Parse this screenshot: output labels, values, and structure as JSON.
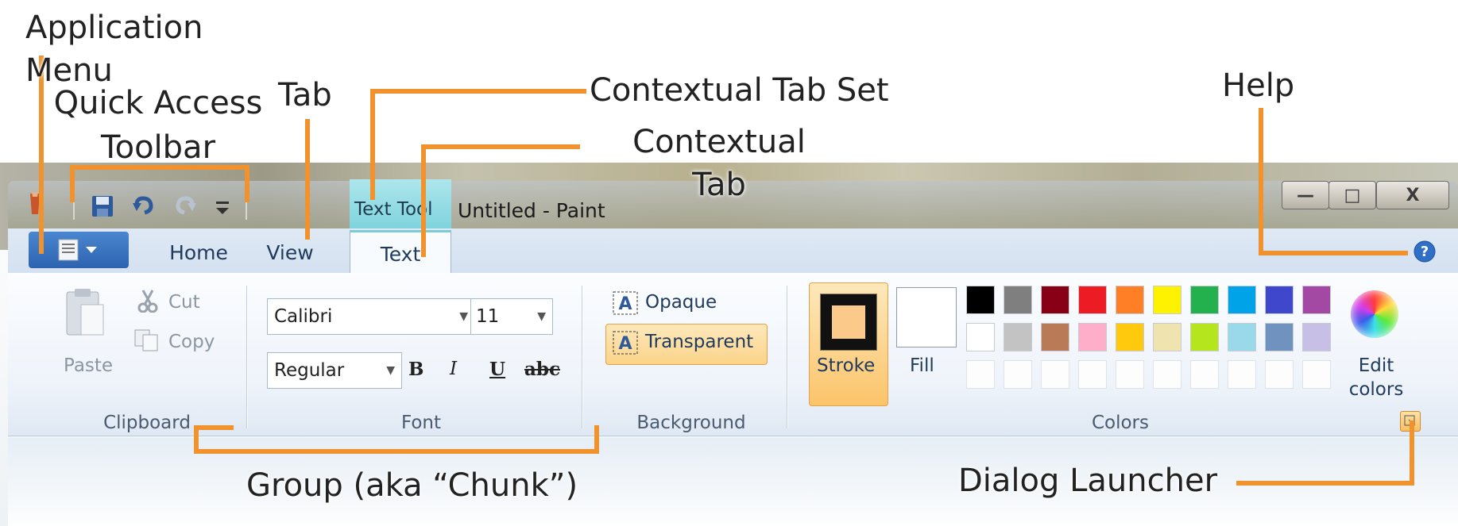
{
  "window": {
    "context_tab_title": "Text Tool",
    "title": "Untitled - Paint",
    "buttons": {
      "minimize": "—",
      "maximize": "□",
      "close": "X"
    }
  },
  "tabs": [
    {
      "label": "Home"
    },
    {
      "label": "View"
    },
    {
      "label": "Text",
      "active": true
    }
  ],
  "clipboard": {
    "paste": "Paste",
    "cut": "Cut",
    "copy": "Copy",
    "group": "Clipboard"
  },
  "font": {
    "family": "Calibri",
    "size": "11",
    "style": "Regular",
    "bold": "B",
    "italic": "I",
    "underline": "U",
    "strike": "abc",
    "group": "Font"
  },
  "background": {
    "opaque": "Opaque",
    "transparent": "Transparent",
    "group": "Background"
  },
  "colors": {
    "stroke": "Stroke",
    "fill": "Fill",
    "edit": "Edit colors",
    "group": "Colors",
    "row1": [
      "#000000",
      "#7f7f7f",
      "#880015",
      "#ed1c24",
      "#ff7f27",
      "#fff200",
      "#22b14c",
      "#00a2e8",
      "#3f48cc",
      "#a349a4"
    ],
    "row2": [
      "#ffffff",
      "#c3c3c3",
      "#b97a57",
      "#ffaec9",
      "#ffc90e",
      "#efe4b0",
      "#b5e61d",
      "#99d9ea",
      "#7092be",
      "#c8bfe7"
    ]
  },
  "annotations": {
    "app_menu": "Application Menu",
    "qat": "Quick Access Toolbar",
    "tab": "Tab",
    "ctx_set": "Contextual Tab Set",
    "ctx_tab": "Contextual Tab",
    "help": "Help",
    "group": "Group (aka “Chunk”)",
    "dialog": "Dialog Launcher"
  },
  "accent": "#f0922e"
}
